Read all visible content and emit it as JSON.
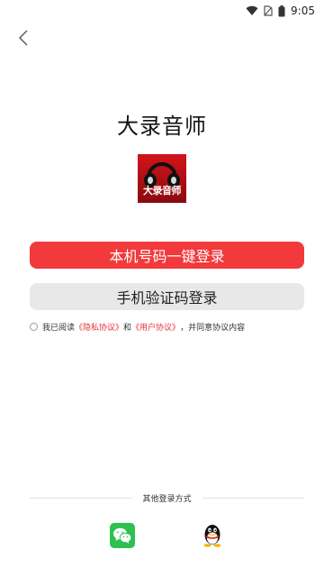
{
  "status_bar": {
    "time": "9:05",
    "icons": [
      "wifi-icon",
      "no-sim-icon",
      "battery-icon"
    ]
  },
  "header": {
    "back_icon": "chevron-left-icon"
  },
  "app": {
    "title": "大录音师",
    "logo_text": "大录音师",
    "logo_icon": "headphones-icon"
  },
  "buttons": {
    "one_click_login": "本机号码一键登录",
    "sms_login": "手机验证码登录"
  },
  "agreement": {
    "prefix": "我已阅读",
    "privacy_link": "《隐私协议》",
    "and": "和",
    "user_link": "《用户协议》",
    "suffix": "，并同意协议内容",
    "checked": false
  },
  "other_login": {
    "label": "其他登录方式",
    "options": [
      "wechat-icon",
      "qq-icon"
    ]
  },
  "colors": {
    "primary": "#f2393b",
    "link": "#e8323a",
    "secondary_button": "#e8e8e8",
    "wechat": "#2dc14f"
  }
}
